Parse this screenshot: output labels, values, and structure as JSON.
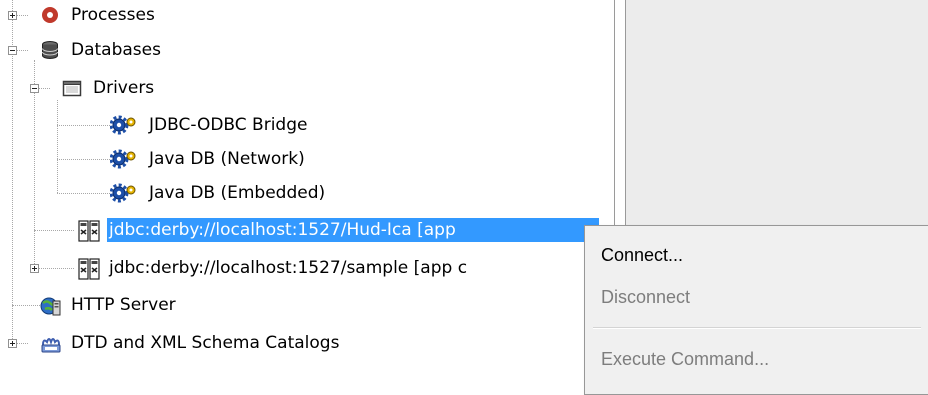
{
  "tree": {
    "nodes": [
      {
        "label": "Processes",
        "icon": "processes-icon"
      },
      {
        "label": "Databases",
        "icon": "databases-icon"
      },
      {
        "label": "Drivers",
        "icon": "folder-icon"
      },
      {
        "label": "JDBC-ODBC Bridge",
        "icon": "driver-icon"
      },
      {
        "label": "Java DB (Network)",
        "icon": "driver-icon"
      },
      {
        "label": "Java DB (Embedded)",
        "icon": "driver-icon"
      },
      {
        "label": "jdbc:derby://localhost:1527/Hud-Ica [app",
        "icon": "db-connection-icon",
        "selected": true
      },
      {
        "label": "jdbc:derby://localhost:1527/sample [app c",
        "icon": "db-connection-icon"
      },
      {
        "label": "HTTP Server",
        "icon": "http-server-icon"
      },
      {
        "label": "DTD and XML Schema Catalogs",
        "icon": "xml-catalog-icon"
      }
    ]
  },
  "context_menu": {
    "items": [
      {
        "label": "Connect...",
        "enabled": true
      },
      {
        "label": "Disconnect",
        "enabled": false
      },
      {
        "label": "Execute Command...",
        "enabled": false
      }
    ]
  },
  "colors": {
    "selection": "#3399ff",
    "menu_background": "#f0f0f0",
    "disabled_text": "#7d7d7d",
    "right_pane": "#ececec"
  }
}
